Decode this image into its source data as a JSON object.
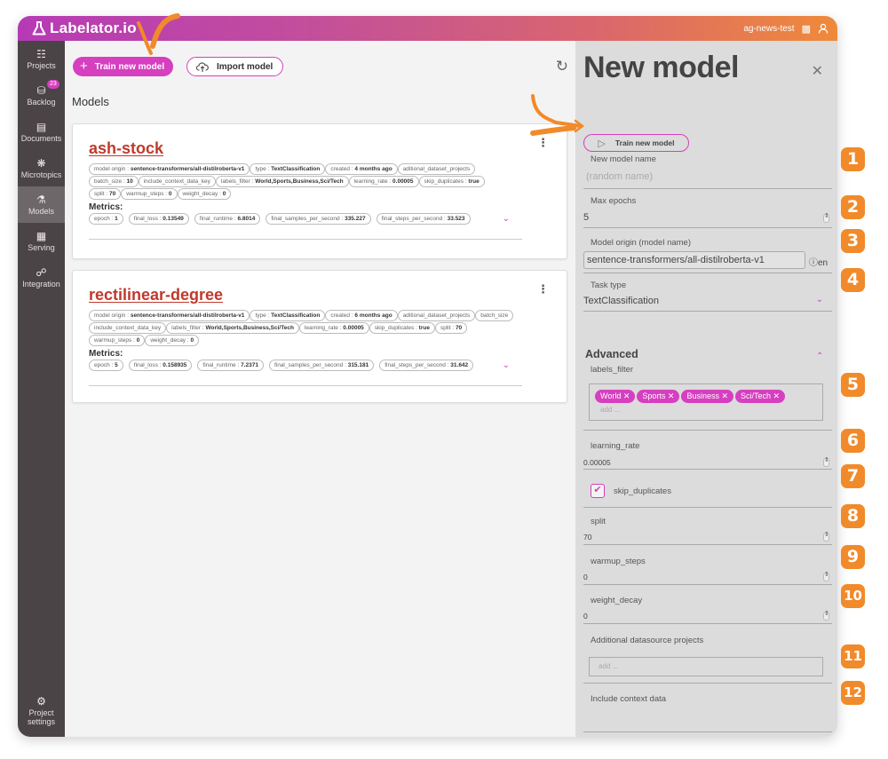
{
  "app": {
    "name": "Labelator.io",
    "project": "ag-news-test",
    "colors": {
      "accent": "#d63fbf",
      "annotation": "#f18a2a",
      "title_red": "#c0392b",
      "sidebar": "#4b4447"
    }
  },
  "sidebar": {
    "items": [
      {
        "label": "Projects",
        "icon": "grid-icon"
      },
      {
        "label": "Backlog",
        "icon": "database-icon",
        "badge": "23"
      },
      {
        "label": "Documents",
        "icon": "documents-icon"
      },
      {
        "label": "Microtopics",
        "icon": "microtopics-icon"
      },
      {
        "label": "Models",
        "icon": "flask-icon",
        "active": true
      },
      {
        "label": "Serving",
        "icon": "server-icon"
      },
      {
        "label": "Integration",
        "icon": "integration-icon"
      }
    ],
    "bottom": {
      "label_line1": "Project",
      "label_line2": "settings",
      "icon": "gear-icon"
    }
  },
  "main": {
    "train_button": "Train new model",
    "import_button": "Import model",
    "section_title": "Models",
    "metrics_label": "Metrics:",
    "models": [
      {
        "name": "ash-stock",
        "params": [
          {
            "k": "model origin",
            "v": "sentence-transformers/all-distilroberta-v1"
          },
          {
            "k": "type",
            "v": "TextClassification"
          },
          {
            "k": "created",
            "v": "4 months ago"
          },
          {
            "k": "aditional_dataset_projects",
            "v": ""
          },
          {
            "k": "batch_size",
            "v": "10"
          },
          {
            "k": "include_context_data_key",
            "v": ""
          },
          {
            "k": "labels_filter",
            "v": "World,Sports,Business,Sci/Tech"
          },
          {
            "k": "learning_rate",
            "v": "0.00005"
          },
          {
            "k": "skip_duplicates",
            "v": "true"
          },
          {
            "k": "split",
            "v": "70"
          },
          {
            "k": "warmup_steps",
            "v": "0"
          },
          {
            "k": "weight_decay",
            "v": "0"
          }
        ],
        "metrics": [
          {
            "k": "epoch",
            "v": "1"
          },
          {
            "k": "final_loss",
            "v": "0.13549"
          },
          {
            "k": "final_runtime",
            "v": "6.8014"
          },
          {
            "k": "final_samples_per_second",
            "v": "335.227"
          },
          {
            "k": "final_steps_per_second",
            "v": "33.523"
          }
        ]
      },
      {
        "name": "rectilinear-degree",
        "params": [
          {
            "k": "model origin",
            "v": "sentence-transformers/all-distilroberta-v1"
          },
          {
            "k": "type",
            "v": "TextClassification"
          },
          {
            "k": "created",
            "v": "6 months ago"
          },
          {
            "k": "aditional_dataset_projects",
            "v": ""
          },
          {
            "k": "batch_size",
            "v": ""
          },
          {
            "k": "include_context_data_key",
            "v": ""
          },
          {
            "k": "labels_filter",
            "v": "World,Sports,Business,Sci/Tech"
          },
          {
            "k": "learning_rate",
            "v": "0.00005"
          },
          {
            "k": "skip_duplicates",
            "v": "true"
          },
          {
            "k": "split",
            "v": "70"
          },
          {
            "k": "warmup_steps",
            "v": "0"
          },
          {
            "k": "weight_decay",
            "v": "0"
          }
        ],
        "metrics": [
          {
            "k": "epoch",
            "v": "5"
          },
          {
            "k": "final_loss",
            "v": "0.158935"
          },
          {
            "k": "final_runtime",
            "v": "7.2371"
          },
          {
            "k": "final_samples_per_second",
            "v": "315.181"
          },
          {
            "k": "final_steps_per_second",
            "v": "31.642"
          }
        ]
      }
    ]
  },
  "panel": {
    "title": "New model",
    "train_button": "Train new model",
    "name_label": "New model name",
    "name_placeholder": "(random name)",
    "epochs_label": "Max epochs",
    "epochs_value": "5",
    "origin_label": "Model origin (model name)",
    "origin_value": "sentence-transformers/all-distilroberta-v1",
    "origin_lang": "en",
    "task_label": "Task type",
    "task_value": "TextClassification",
    "advanced_label": "Advanced",
    "labels_filter_label": "labels_filter",
    "labels": [
      "World",
      "Sports",
      "Business",
      "Sci/Tech"
    ],
    "add_placeholder": "add ...",
    "learning_rate_label": "learning_rate",
    "learning_rate_value": "0.00005",
    "skip_duplicates_label": "skip_duplicates",
    "skip_duplicates_checked": true,
    "split_label": "split",
    "split_value": "70",
    "warmup_label": "warmup_steps",
    "warmup_value": "0",
    "weight_decay_label": "weight_decay",
    "weight_decay_value": "0",
    "additional_label": "Additional datasource projects",
    "context_label": "Include context data"
  },
  "annotations": [
    "1",
    "2",
    "3",
    "4",
    "5",
    "6",
    "7",
    "8",
    "9",
    "10",
    "11",
    "12"
  ]
}
